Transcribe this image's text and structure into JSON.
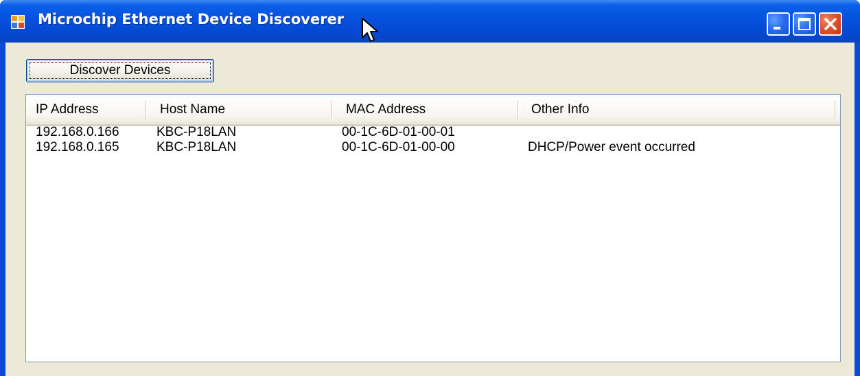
{
  "window": {
    "title": "Microchip Ethernet Device Discoverer"
  },
  "toolbar": {
    "discover_button_label": "Discover Devices"
  },
  "devices_table": {
    "columns": [
      "IP Address",
      "Host Name",
      "MAC Address",
      "Other Info"
    ],
    "rows": [
      [
        "192.168.0.166",
        "KBC-P18LAN",
        "00-1C-6D-01-00-01",
        ""
      ],
      [
        "192.168.0.165",
        "KBC-P18LAN",
        "00-1C-6D-01-00-00",
        "DHCP/Power event occurred"
      ]
    ]
  },
  "icons": {
    "app": "app-window-icon",
    "minimize": "minimize-icon",
    "maximize": "maximize-icon",
    "close": "close-icon"
  }
}
